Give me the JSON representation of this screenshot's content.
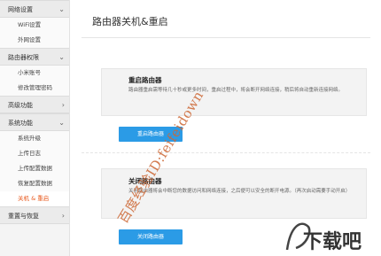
{
  "sidebar": {
    "sections": [
      {
        "label": "网络设置",
        "chevron": "⌄",
        "items": [
          {
            "label": "WiFi设置",
            "active": false
          },
          {
            "label": "外网设置",
            "active": false
          }
        ]
      },
      {
        "label": "路由器权限",
        "chevron": "⌄",
        "items": [
          {
            "label": "小米账号",
            "active": false
          },
          {
            "label": "修改管理密码",
            "active": false
          }
        ]
      },
      {
        "label": "高级功能",
        "chevron": "›",
        "items": []
      },
      {
        "label": "系统功能",
        "chevron": "⌄",
        "items": [
          {
            "label": "系统升级",
            "active": false
          },
          {
            "label": "上传日志",
            "active": false
          },
          {
            "label": "上传配置数据",
            "active": false
          },
          {
            "label": "恢复配置数据",
            "active": false
          },
          {
            "label": "关机 & 重启",
            "active": true
          }
        ]
      },
      {
        "label": "重置与恢复",
        "chevron": "›",
        "items": []
      }
    ]
  },
  "main": {
    "title": "路由器关机&重启",
    "restart": {
      "title": "重启路由器",
      "desc": "路由器重启需等待几十秒或更多时间，重启过程中，将会断开网络连接，稍后将自动重新连接网络。",
      "button": "重启路由器"
    },
    "shutdown": {
      "title": "关闭路由器",
      "desc": "关闭路由器将会中断您的数据访问和网络连接，之后便可以安全的断开电源。（再次启动需要手动开启）",
      "button": "关闭路由器"
    }
  },
  "watermark": "百度经验ID:feifeidown",
  "logo_text": "下载吧",
  "colors": {
    "accent": "#e85a1f",
    "button": "#2b9be6",
    "sidebar_bg": "#f4f4f4"
  }
}
